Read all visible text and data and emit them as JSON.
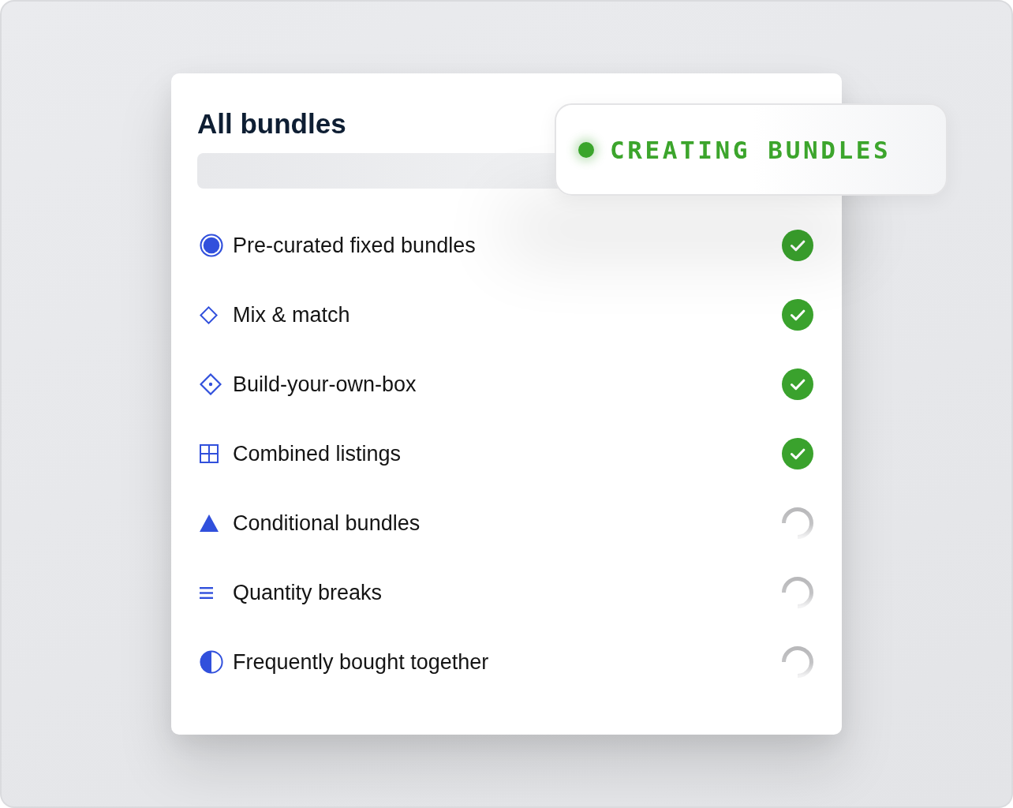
{
  "card": {
    "title": "All bundles"
  },
  "badge": {
    "label": "CREATING BUNDLES"
  },
  "bundles": [
    {
      "label": "Pre-curated fixed bundles",
      "done": true
    },
    {
      "label": "Mix & match",
      "done": true
    },
    {
      "label": "Build-your-own-box",
      "done": true
    },
    {
      "label": "Combined listings",
      "done": true
    },
    {
      "label": "Conditional bundles",
      "done": false
    },
    {
      "label": "Quantity breaks",
      "done": false
    },
    {
      "label": "Frequently bought together",
      "done": false
    }
  ]
}
